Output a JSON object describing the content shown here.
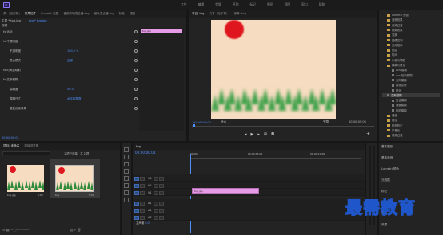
{
  "menu": {
    "items": [
      "文件",
      "编辑",
      "剪辑",
      "序列",
      "标记",
      "图形",
      "视图",
      "窗口",
      "帮助"
    ],
    "logo": "Pr"
  },
  "effect_controls": {
    "tabs": [
      "源：(无剪辑)",
      "效果控件",
      "Lumetri 范围",
      "音频剪辑混合器:tog",
      "音轨混合器:tog",
      "标准",
      "插图"
    ],
    "source_label": "主要 * tog.jpg",
    "sequence_label": "tog * tog.jpg",
    "timeline_clip_label": "tog.jpg",
    "section_video": "视频",
    "rows": [
      {
        "label": "fx 运动",
        "value": ""
      },
      {
        "label": "fx 不透明度",
        "value": ""
      },
      {
        "label": "不透明度",
        "value": "100.0 %"
      },
      {
        "label": "混合模式",
        "value": "正常"
      },
      {
        "label": "fx 时间重映射",
        "value": ""
      },
      {
        "label": "fx 高斯模糊",
        "value": ""
      },
      {
        "label": "模糊度",
        "value": "50.0"
      },
      {
        "label": "模糊尺寸",
        "value": "水平和垂直"
      },
      {
        "label": "重复边缘像素",
        "value": ""
      }
    ],
    "timecode": "00:00:00:01"
  },
  "program": {
    "tabs": [
      "节目: tog",
      "文本（无字幕）",
      "参考: tog"
    ],
    "timecode": "00:00:00:01",
    "fit": "适合",
    "quality": "完整",
    "duration": "00:00:05:00"
  },
  "effects": {
    "items": [
      {
        "label": "Lumetri 预设",
        "folder": true,
        "sel": false
      },
      {
        "label": "音频效果",
        "folder": true,
        "sel": false
      },
      {
        "label": "音频过渡",
        "folder": true,
        "sel": false
      },
      {
        "label": "视频效果",
        "folder": true,
        "sel": false
      },
      {
        "label": "变换",
        "folder": true,
        "sel": false
      },
      {
        "label": "图像控制",
        "folder": true,
        "sel": false
      },
      {
        "label": "实用程序",
        "folder": true,
        "sel": false
      },
      {
        "label": "扭曲",
        "folder": true,
        "sel": false
      },
      {
        "label": "时间",
        "folder": true,
        "sel": false
      },
      {
        "label": "杂色与颗粒",
        "folder": true,
        "sel": false
      },
      {
        "label": "模糊与锐化",
        "folder": true,
        "sel": false
      },
      {
        "label": "Acs 模糊",
        "folder": false,
        "sel": false
      },
      {
        "label": "Acs 相机模糊",
        "folder": false,
        "sel": false
      },
      {
        "label": "方向模糊",
        "folder": false,
        "sel": false
      },
      {
        "label": "钝化蒙版",
        "folder": false,
        "sel": false
      },
      {
        "label": "锐化",
        "folder": false,
        "sel": false
      },
      {
        "label": "高斯模糊",
        "folder": false,
        "sel": true
      },
      {
        "label": "复合模糊",
        "folder": false,
        "sel": false
      },
      {
        "label": "通道模糊",
        "folder": false,
        "sel": false
      },
      {
        "label": "相机模糊",
        "folder": false,
        "sel": false
      },
      {
        "label": "通道",
        "folder": true,
        "sel": false
      },
      {
        "label": "键控",
        "folder": true,
        "sel": false
      },
      {
        "label": "颜色校正",
        "folder": true,
        "sel": false
      },
      {
        "label": "风格化",
        "folder": true,
        "sel": false
      },
      {
        "label": "视频过渡",
        "folder": true,
        "sel": false
      }
    ]
  },
  "project": {
    "tabs": [
      "项目: 未命名",
      "媒体浏览器"
    ],
    "search_placeholder": "",
    "count": "1 项已选择，共 2 项",
    "items": [
      {
        "name": "tog.jpg",
        "dur": "5:00"
      },
      {
        "name": "tog",
        "dur": "5:00"
      }
    ]
  },
  "timeline": {
    "tab": "tog",
    "timecode": "00:00:00:01",
    "ruler": [
      "00:00",
      "00:00:05:00",
      "00:00:10:00"
    ],
    "video_tracks": [
      "V3",
      "V2",
      "V1"
    ],
    "audio_tracks": [
      "A1",
      "A2",
      "A3"
    ],
    "master": "主声道",
    "master_value": "0.0",
    "clip_label": "tog.jpg"
  },
  "right_panel": {
    "items": [
      "基本图形",
      "基本声音",
      "Lumetri 颜色",
      "元数据",
      "标记",
      "历史记录",
      "信息",
      "效果"
    ]
  },
  "watermark": "最需教育"
}
